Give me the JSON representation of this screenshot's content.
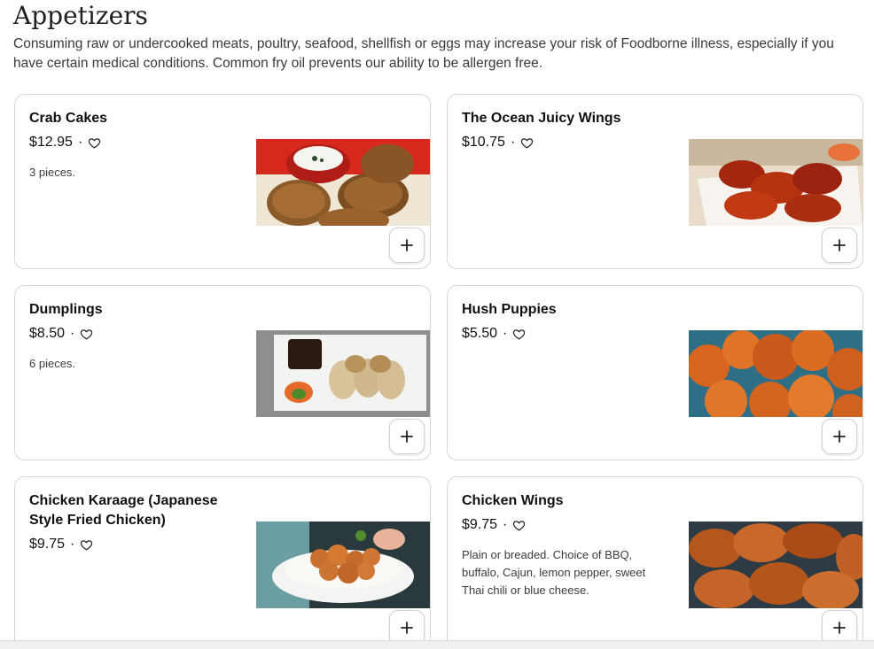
{
  "section": {
    "title": "Appetizers",
    "description": "Consuming raw or undercooked meats, poultry, seafood, shellfish or eggs may increase your risk of Foodborne illness, especially if you have certain medical conditions. Common fry oil prevents our ability to be allergen free."
  },
  "items": [
    {
      "name": "Crab Cakes",
      "price": "$12.95",
      "separator": "·",
      "description": "3 pieces.",
      "image_icon": "crab-cakes-photo",
      "add_icon": "plus-icon",
      "favorite_icon": "heart-icon"
    },
    {
      "name": "The Ocean Juicy Wings",
      "price": "$10.75",
      "separator": "·",
      "description": "",
      "image_icon": "wings-photo",
      "add_icon": "plus-icon",
      "favorite_icon": "heart-icon"
    },
    {
      "name": "Dumplings",
      "price": "$8.50",
      "separator": "·",
      "description": "6 pieces.",
      "image_icon": "dumplings-photo",
      "add_icon": "plus-icon",
      "favorite_icon": "heart-icon"
    },
    {
      "name": "Hush Puppies",
      "price": "$5.50",
      "separator": "·",
      "description": "",
      "image_icon": "hush-puppies-photo",
      "add_icon": "plus-icon",
      "favorite_icon": "heart-icon"
    },
    {
      "name": "Chicken Karaage (Japanese Style Fried Chicken)",
      "price": "$9.75",
      "separator": "·",
      "description": "",
      "image_icon": "karaage-photo",
      "add_icon": "plus-icon",
      "favorite_icon": "heart-icon"
    },
    {
      "name": "Chicken Wings",
      "price": "$9.75",
      "separator": "·",
      "description": "Plain or breaded. Choice of BBQ, buffalo, Cajun, lemon pepper, sweet Thai chili or blue cheese.",
      "image_icon": "chicken-wings-photo",
      "add_icon": "plus-icon",
      "favorite_icon": "heart-icon"
    }
  ],
  "colors": {
    "border": "#d6d6d6",
    "text": "#111111",
    "muted": "#3c3c3c"
  }
}
